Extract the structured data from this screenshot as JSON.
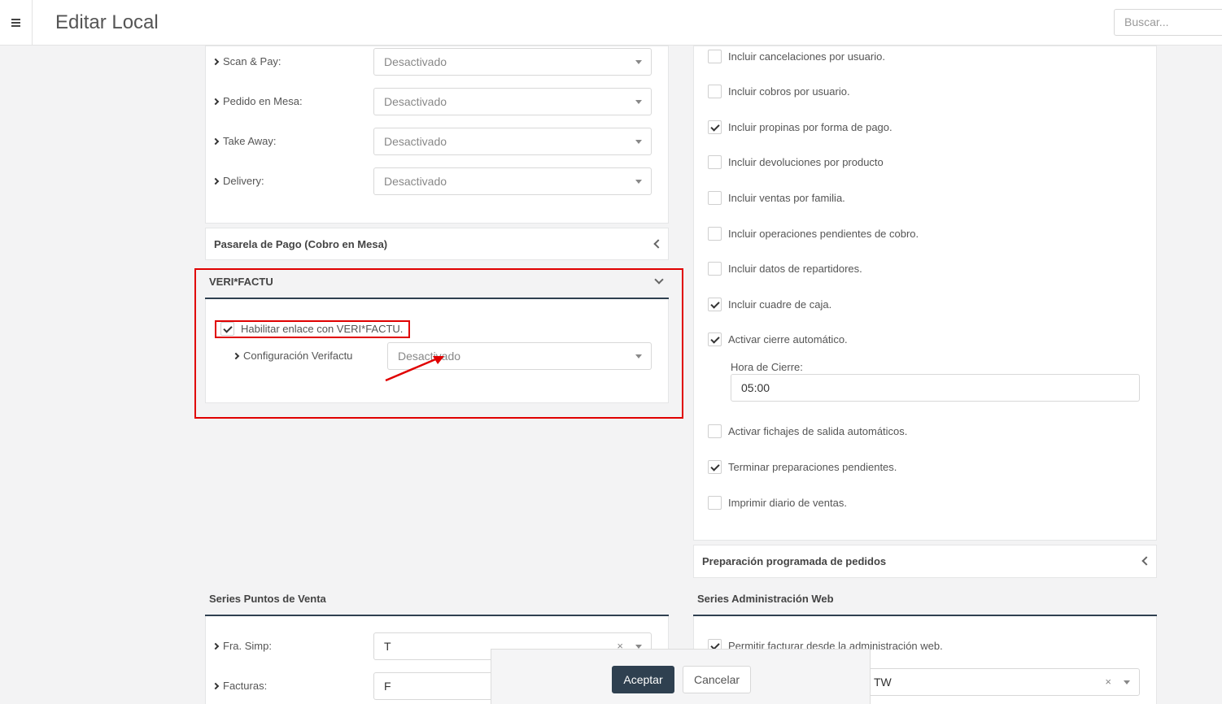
{
  "header": {
    "title": "Editar Local",
    "search_placeholder": "Buscar..."
  },
  "channels": [
    {
      "label": "Scan & Pay:",
      "value": "Desactivado"
    },
    {
      "label": "Pedido en Mesa:",
      "value": "Desactivado"
    },
    {
      "label": "Take Away:",
      "value": "Desactivado"
    },
    {
      "label": "Delivery:",
      "value": "Desactivado"
    }
  ],
  "pasarela": {
    "title": "Pasarela de Pago (Cobro en Mesa)"
  },
  "verifactu": {
    "title": "VERI*FACTU",
    "enable_label": "Habilitar enlace con VERI*FACTU.",
    "enable_checked": true,
    "config_label": "Configuración Verifactu",
    "config_value": "Desactivado"
  },
  "report_options": [
    {
      "label": "Incluir cancelaciones por usuario.",
      "checked": false
    },
    {
      "label": "Incluir cobros por usuario.",
      "checked": false
    },
    {
      "label": "Incluir propinas por forma de pago.",
      "checked": true
    },
    {
      "label": "Incluir devoluciones por producto",
      "checked": false
    },
    {
      "label": "Incluir ventas por familia.",
      "checked": false
    },
    {
      "label": "Incluir operaciones pendientes de cobro.",
      "checked": false
    },
    {
      "label": "Incluir datos de repartidores.",
      "checked": false
    },
    {
      "label": "Incluir cuadre de caja.",
      "checked": true
    },
    {
      "label": "Activar cierre automático.",
      "checked": true
    }
  ],
  "closing": {
    "label": "Hora de Cierre:",
    "value": "05:00"
  },
  "more_options": [
    {
      "label": "Activar fichajes de salida automáticos.",
      "checked": false
    },
    {
      "label": "Terminar preparaciones pendientes.",
      "checked": true
    },
    {
      "label": "Imprimir diario de ventas.",
      "checked": false
    }
  ],
  "scheduled": {
    "title": "Preparación programada de pedidos"
  },
  "series_pos": {
    "title": "Series Puntos de Venta",
    "rows": [
      {
        "label": "Fra. Simp:",
        "value": "T"
      },
      {
        "label": "Facturas:",
        "value": "F"
      }
    ]
  },
  "series_web": {
    "title": "Series Administración Web",
    "allow_label": "Permitir facturar desde la administración web.",
    "allow_checked": true,
    "value": "TW"
  },
  "footer": {
    "accept": "Aceptar",
    "cancel": "Cancelar"
  },
  "icons": {
    "clear": "×"
  }
}
